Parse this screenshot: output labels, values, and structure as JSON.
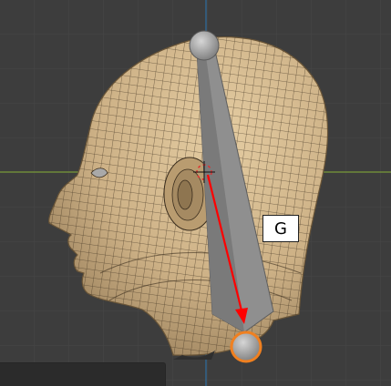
{
  "viewport": {
    "background": "#3d3d3d",
    "grid_color": "#454545",
    "x_axis_color": "#7a9a3a",
    "z_axis_color": "#2f6f9f",
    "mesh_color": "#d6bd93",
    "wire_color": "#3a2d1d",
    "bone_color": "#9a9a9a",
    "selected_joint_color": "#f08020",
    "arrow_color": "#ff0000"
  },
  "overlay": {
    "key_label": "G"
  }
}
